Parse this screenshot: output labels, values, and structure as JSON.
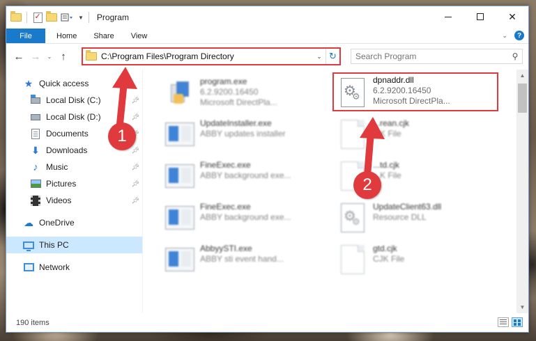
{
  "window": {
    "title": "Program",
    "status": "190 items"
  },
  "ribbon": {
    "tabs": [
      "File",
      "Home",
      "Share",
      "View"
    ]
  },
  "address": {
    "path": "C:\\Program Files\\Program Directory"
  },
  "search": {
    "placeholder": "Search Program"
  },
  "sidebar": {
    "quick_access": "Quick access",
    "items": [
      {
        "label": "Local Disk (C:)",
        "icon": "local-disk-c-icon"
      },
      {
        "label": "Local Disk (D:)",
        "icon": "local-disk-d-icon"
      },
      {
        "label": "Documents",
        "icon": "documents-icon"
      },
      {
        "label": "Downloads",
        "icon": "downloads-icon"
      },
      {
        "label": "Music",
        "icon": "music-icon"
      },
      {
        "label": "Pictures",
        "icon": "pictures-icon"
      },
      {
        "label": "Videos",
        "icon": "videos-icon"
      }
    ],
    "onedrive": "OneDrive",
    "this_pc": "This PC",
    "network": "Network"
  },
  "files": [
    {
      "name": "program.exe",
      "line1": "6.2.9200.16450",
      "line2": "Microsoft DirectPla..."
    },
    {
      "name": "UpdateInstaller.exe",
      "line1": "ABBY updates installer",
      "line2": ""
    },
    {
      "name": "FineExec.exe",
      "line1": "ABBY background exe...",
      "line2": ""
    },
    {
      "name": "FineExec.exe",
      "line1": "ABBY background exe...",
      "line2": ""
    },
    {
      "name": "AbbyySTI.exe",
      "line1": "ABBY sti event hand...",
      "line2": ""
    },
    {
      "name": "dpnaddr.dll",
      "line1": "6.2.9200.16450",
      "line2": "Microsoft DirectPla..."
    },
    {
      "name": "...rean.cjk",
      "line1": "...K File",
      "line2": ""
    },
    {
      "name": "...td.cjk",
      "line1": "...K File",
      "line2": ""
    },
    {
      "name": "UpdateClient63.dll",
      "line1": "Resource DLL",
      "line2": ""
    },
    {
      "name": "gtd.cjk",
      "line1": "CJK File",
      "line2": ""
    }
  ],
  "annotations": {
    "step1": "1",
    "step2": "2",
    "color": "#e0393e"
  },
  "colors": {
    "accent": "#1979ca",
    "highlight": "#e0393e",
    "selected": "#cce8ff"
  }
}
